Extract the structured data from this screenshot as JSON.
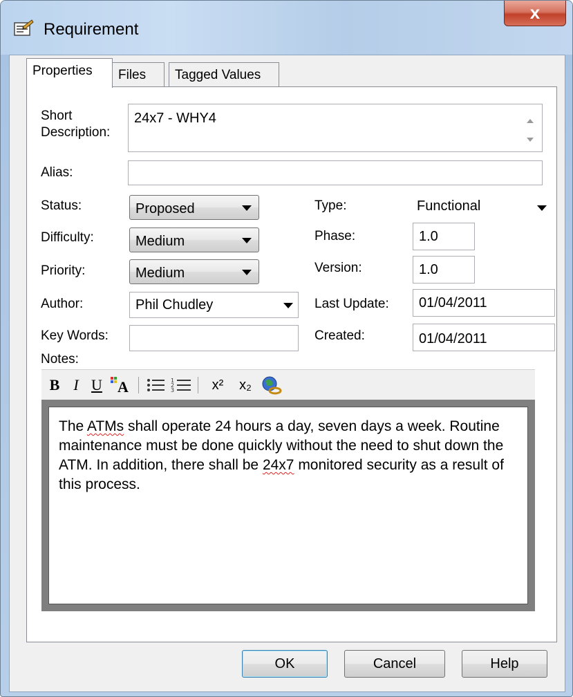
{
  "window": {
    "title": "Requirement",
    "close_glyph": "x"
  },
  "tabs": [
    {
      "label": "Properties",
      "active": true
    },
    {
      "label": "Files",
      "active": false
    },
    {
      "label": "Tagged Values",
      "active": false
    }
  ],
  "form": {
    "short_description": {
      "label_line1": "Short",
      "label_line2": "Description:",
      "value": "24x7 - WHY4"
    },
    "alias": {
      "label": "Alias:",
      "value": ""
    },
    "status": {
      "label": "Status:",
      "value": "Proposed"
    },
    "difficulty": {
      "label": "Difficulty:",
      "value": "Medium"
    },
    "priority": {
      "label": "Priority:",
      "value": "Medium"
    },
    "author": {
      "label": "Author:",
      "value": "Phil Chudley"
    },
    "key_words": {
      "label": "Key Words:",
      "value": ""
    },
    "type": {
      "label": "Type:",
      "value": "Functional"
    },
    "phase": {
      "label": "Phase:",
      "value": "1.0"
    },
    "version": {
      "label": "Version:",
      "value": "1.0"
    },
    "last_update": {
      "label": "Last Update:",
      "value": "01/04/2011"
    },
    "created": {
      "label": "Created:",
      "value": "01/04/2011"
    },
    "notes_label": "Notes:"
  },
  "toolbar": {
    "bold": "B",
    "italic": "I",
    "underline": "U",
    "superscript": "x²",
    "subscript": "x₂"
  },
  "notes": {
    "part1": "The ",
    "word_atms": "ATMs",
    "part2": " shall operate 24 hours a day, seven days a week. Routine maintenance must be done quickly without the need to shut down the ATM. In addition, there shall be ",
    "word_247": "24x7",
    "part3": " monitored security as a result of this process."
  },
  "buttons": {
    "ok": "OK",
    "cancel": "Cancel",
    "help": "Help"
  },
  "colors": {
    "accent": "#3c7fb1",
    "close": "#c1412a",
    "spell_error": "#e02020"
  }
}
